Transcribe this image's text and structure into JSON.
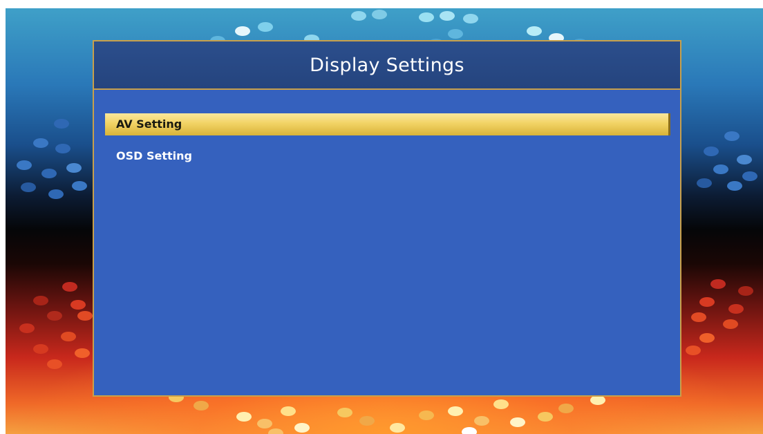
{
  "panel": {
    "title": "Display Settings"
  },
  "menu": {
    "items": [
      {
        "label": "AV Setting",
        "selected": true
      },
      {
        "label": "OSD Setting",
        "selected": false
      }
    ]
  },
  "colors": {
    "panel_background": "#3561be",
    "header_background": "#2b4e8c",
    "border": "#c9a04a",
    "highlight": "#f2d365"
  }
}
